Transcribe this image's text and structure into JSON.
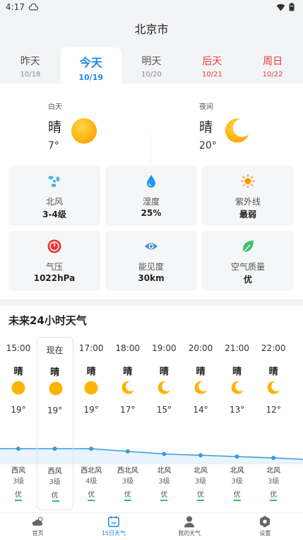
{
  "status": {
    "time": "4:17"
  },
  "header": {
    "city": "北京市"
  },
  "day_tabs": [
    {
      "name": "昨天",
      "date": "10/18",
      "weekend": false,
      "active": false
    },
    {
      "name": "今天",
      "date": "10/19",
      "weekend": false,
      "active": true
    },
    {
      "name": "明天",
      "date": "10/20",
      "weekend": false,
      "active": false
    },
    {
      "name": "后天",
      "date": "10/21",
      "weekend": true,
      "active": false
    },
    {
      "name": "周日",
      "date": "10/22",
      "weekend": true,
      "active": false
    }
  ],
  "today": {
    "day": {
      "label": "白天",
      "condition": "晴",
      "temp": "7°",
      "icon": "sun-icon"
    },
    "night": {
      "label": "夜间",
      "condition": "晴",
      "temp": "20°",
      "icon": "moon-icon"
    }
  },
  "details": [
    {
      "label": "北风",
      "value": "3-4级",
      "icon": "wind-icon",
      "color": "#4fb3e8"
    },
    {
      "label": "湿度",
      "value": "25%",
      "icon": "humidity-drop-icon",
      "color": "#2196f3"
    },
    {
      "label": "紫外线",
      "value": "最弱",
      "icon": "uv-sun-icon",
      "color": "#ff9800"
    },
    {
      "label": "气压",
      "value": "1022hPa",
      "icon": "pressure-gauge-icon",
      "color": "#e53935"
    },
    {
      "label": "能见度",
      "value": "30km",
      "icon": "eye-icon",
      "color": "#3f8fe0"
    },
    {
      "label": "空气质量",
      "value": "优",
      "icon": "leaf-icon",
      "color": "#43c16b"
    }
  ],
  "hourly": {
    "title": "未来24小时天气",
    "items": [
      {
        "time": "15:00",
        "condition": "晴",
        "icon": "sun-icon",
        "temp": "19°",
        "temp_value": 19,
        "wind_dir": "西风",
        "wind_level": "3级",
        "aqi": "优",
        "now": false
      },
      {
        "time": "现在",
        "condition": "晴",
        "icon": "sun-icon",
        "temp": "19°",
        "temp_value": 19,
        "wind_dir": "西风",
        "wind_level": "3级",
        "aqi": "优",
        "now": true
      },
      {
        "time": "17:00",
        "condition": "晴",
        "icon": "sun-icon",
        "temp": "19°",
        "temp_value": 19,
        "wind_dir": "西北风",
        "wind_level": "4级",
        "aqi": "优",
        "now": false
      },
      {
        "time": "18:00",
        "condition": "晴",
        "icon": "moon-icon",
        "temp": "17°",
        "temp_value": 17,
        "wind_dir": "西北风",
        "wind_level": "3级",
        "aqi": "优",
        "now": false
      },
      {
        "time": "19:00",
        "condition": "晴",
        "icon": "moon-icon",
        "temp": "15°",
        "temp_value": 15,
        "wind_dir": "北风",
        "wind_level": "3级",
        "aqi": "优",
        "now": false
      },
      {
        "time": "20:00",
        "condition": "晴",
        "icon": "moon-icon",
        "temp": "14°",
        "temp_value": 14,
        "wind_dir": "北风",
        "wind_level": "3级",
        "aqi": "优",
        "now": false
      },
      {
        "time": "21:00",
        "condition": "晴",
        "icon": "moon-icon",
        "temp": "13°",
        "temp_value": 13,
        "wind_dir": "北风",
        "wind_level": "3级",
        "aqi": "优",
        "now": false
      },
      {
        "time": "22:00",
        "condition": "晴",
        "icon": "moon-icon",
        "temp": "12°",
        "temp_value": 12,
        "wind_dir": "北风",
        "wind_level": "3级",
        "aqi": "优",
        "now": false
      }
    ]
  },
  "tabbar": [
    {
      "label": "首页",
      "icon": "cloud-sun-icon",
      "active": false
    },
    {
      "label": "15日天气",
      "icon": "calendar-icon",
      "active": true
    },
    {
      "label": "我的天气",
      "icon": "user-icon",
      "active": false
    },
    {
      "label": "设置",
      "icon": "settings-icon",
      "active": false
    }
  ],
  "colors": {
    "accent": "#1e88e5",
    "weekend": "#e53935",
    "sun": "#ffb300",
    "curve": "#3a9ad9",
    "aqi_good": "#2ec36b"
  }
}
